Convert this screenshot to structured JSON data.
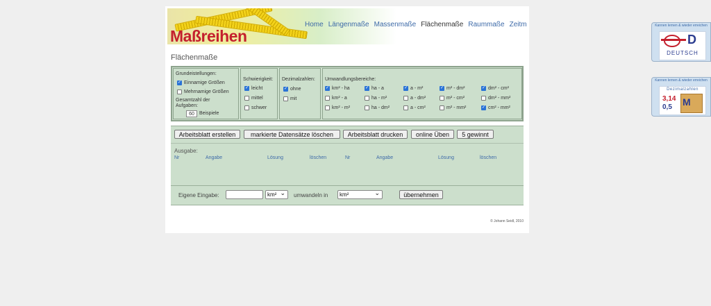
{
  "logo": {
    "text": "Maßreihen"
  },
  "nav": {
    "items": [
      "Home",
      "Längenmaße",
      "Massenmaße",
      "Flächenmaße",
      "Raummaße",
      "Zeitmaße"
    ],
    "active_index": 3
  },
  "page_title": "Flächenmaße",
  "settings": {
    "grund": {
      "title": "Grundeistellungen:",
      "opt1": "Einnamige Größen",
      "opt1_checked": true,
      "opt2": "Mehrnamige Größen",
      "opt2_checked": false,
      "total_label": "Gesamtzahl der Aufgaben:",
      "total_value": "60",
      "total_unit": "Beispiele"
    },
    "schwierigkeit": {
      "title": "Schwierigkeit:",
      "options": [
        {
          "label": "leicht",
          "checked": true
        },
        {
          "label": "mittel",
          "checked": false
        },
        {
          "label": "schwer",
          "checked": false
        }
      ]
    },
    "dezimal": {
      "title": "Dezimalzahlen:",
      "options": [
        {
          "label": "ohne",
          "checked": true
        },
        {
          "label": "mit",
          "checked": false
        }
      ]
    },
    "umwandlung": {
      "title": "Umwandlungsbereiche:",
      "rows": [
        [
          {
            "label": "km² - ha",
            "checked": true
          },
          {
            "label": "ha - a",
            "checked": true
          },
          {
            "label": "a - m²",
            "checked": true
          },
          {
            "label": "m² - dm²",
            "checked": true
          },
          {
            "label": "dm² - cm²",
            "checked": true
          }
        ],
        [
          {
            "label": "km² - a",
            "checked": false
          },
          {
            "label": "ha - m²",
            "checked": false
          },
          {
            "label": "a - dm²",
            "checked": false
          },
          {
            "label": "m² - cm²",
            "checked": false
          },
          {
            "label": "dm² - mm²",
            "checked": false
          }
        ],
        [
          {
            "label": "km² - m²",
            "checked": false
          },
          {
            "label": "ha - dm²",
            "checked": false
          },
          {
            "label": "a - cm²",
            "checked": false
          },
          {
            "label": "m² - mm²",
            "checked": false
          },
          {
            "label": "cm² - mm²",
            "checked": true
          }
        ]
      ]
    }
  },
  "buttons": {
    "create": "Arbeitsblatt erstellen",
    "delete": "markierte Datensätze löschen",
    "print": "Arbeitsblatt drucken",
    "online": "online Üben",
    "win": "5 gewinnt"
  },
  "output": {
    "label": "Ausgabe:",
    "headers": [
      "Nr",
      "Angabe",
      "Lösung",
      "löschen",
      "Nr",
      "Angabe",
      "Lösung",
      "löschen"
    ]
  },
  "input_row": {
    "label": "Eigene Eingabe:",
    "value": "",
    "from_unit": "km²",
    "convert_label": "umwandeln in",
    "to_unit": "km²",
    "apply": "übernehmen"
  },
  "copyright": "© Johann Seidl, 2010",
  "side_badges": [
    {
      "top_text": "Kannen lernen & wieder erreichen",
      "title": "DEUTSCH",
      "accent": "#2b3c8f"
    },
    {
      "top_text": "Kannen lernen & wieder erreichen",
      "title": "Dezimalzahlen",
      "accent": "#3d6aa8"
    }
  ]
}
